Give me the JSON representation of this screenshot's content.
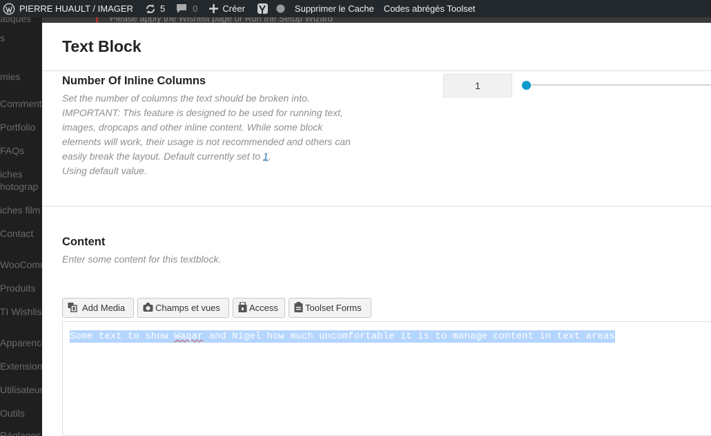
{
  "admin_bar": {
    "site_name": "PIERRE HUAULT / IMAGER",
    "updates_count": "5",
    "comments_count": "0",
    "new_label": "Créer",
    "clear_cache": "Supprimer le Cache",
    "shortcodes": "Codes abrégés Toolset",
    "icons": [
      "wordpress-icon",
      "sync-icon",
      "comment-icon",
      "plus-icon",
      "yoast-icon",
      "status-dot-icon"
    ]
  },
  "background": {
    "notice_text": "Please apply the Wishlist page or Run the Setup Wizard",
    "sidebar": [
      "atiques",
      "s",
      "mies",
      "Commenta",
      "Portfolio",
      "FAQs",
      "iches",
      "hotograp",
      "iches film",
      "Contact",
      "WooComm",
      "Produits",
      "TI Wishlis",
      "Apparence",
      "Extensions",
      "Utilisateur",
      "Outils",
      "Réglages"
    ]
  },
  "modal": {
    "title": "Text Block",
    "columns_param": {
      "title": "Number Of Inline Columns",
      "desc_lines": [
        "Set the number of columns the text should be broken into.",
        "IMPORTANT: This feature is designed to be used for running text,",
        "images, dropcaps and other inline content. While some block",
        "elements will work, their usage is not recommended and others can"
      ],
      "desc_line5_prefix": "easily break the layout. Default currently set to ",
      "desc_default_link": "1",
      "desc_line5_suffix": ".",
      "desc_line6": "Using default value.",
      "value": "1",
      "slider_color": "#0a9bcd"
    },
    "content_param": {
      "title": "Content",
      "desc": "Enter some content for this textblock."
    },
    "toolbar": {
      "add_media": "Add Media",
      "fields_views": "Champs et vues",
      "access": "Access",
      "toolset_forms": "Toolset Forms"
    },
    "editor": {
      "text_before": "Some text to show ",
      "misspelled": "Waqar",
      "text_after": " and Nigel how much uncomfortable it is to manage content in text areas",
      "selection_color": "#b4d5fe"
    }
  }
}
